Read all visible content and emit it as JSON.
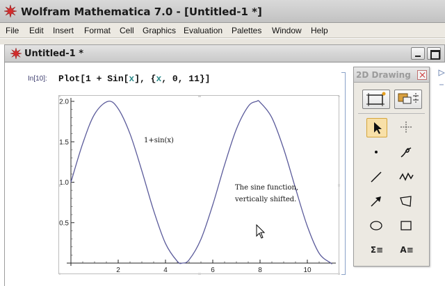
{
  "window": {
    "title": "Wolfram Mathematica 7.0 - [Untitled-1 *]"
  },
  "menu": [
    "File",
    "Edit",
    "Insert",
    "Format",
    "Cell",
    "Graphics",
    "Evaluation",
    "Palettes",
    "Window",
    "Help"
  ],
  "notebook": {
    "title": "Untitled-1 *",
    "input_label": "In[10]:",
    "input_code": {
      "before": "Plot[1 + Sin[",
      "var1": "x",
      "middle": "], {",
      "var2": "x",
      "after": ", 0, 11}]"
    }
  },
  "plot": {
    "annotation_function": "1+sin(x)",
    "annotation_line1": "The sine function,",
    "annotation_line2": "vertically shifted."
  },
  "chart_data": {
    "type": "line",
    "function": "1 + Sin[x]",
    "x": [
      0,
      0.5,
      1,
      1.5708,
      2,
      2.5,
      3,
      3.5,
      4,
      4.5,
      4.7124,
      5,
      5.5,
      6,
      6.5,
      7,
      7.5,
      7.854,
      8,
      8.5,
      9,
      9.5,
      10,
      10.5,
      10.9956,
      11
    ],
    "y": [
      1.0,
      1.479,
      1.841,
      2.0,
      1.909,
      1.598,
      1.141,
      0.649,
      0.243,
      0.022,
      0.0,
      0.041,
      0.295,
      0.721,
      1.215,
      1.657,
      1.938,
      2.0,
      1.989,
      1.798,
      1.412,
      0.925,
      0.456,
      0.121,
      0.0,
      0.0
    ],
    "xlim": [
      0,
      11
    ],
    "ylim": [
      0,
      2
    ],
    "x_ticks": [
      "2",
      "4",
      "6",
      "8",
      "10"
    ],
    "y_ticks": [
      "0.5",
      "1.0",
      "1.5",
      "2.0"
    ],
    "line_color": "#5a5a9a"
  },
  "palette": {
    "title": "2D Drawing",
    "tools": [
      "select-arrow-icon",
      "crosshair-icon",
      "point-icon",
      "freehand-icon",
      "line-icon",
      "polyline-icon",
      "arrow-icon",
      "polygon-icon",
      "ellipse-icon",
      "rectangle-icon",
      "math-text-icon",
      "text-icon"
    ],
    "math_text_label": "Σ≡",
    "text_label": "A≡"
  },
  "colors": {
    "code_symbol": "#2e8b8b",
    "active_tool": "#f8e0a8"
  }
}
